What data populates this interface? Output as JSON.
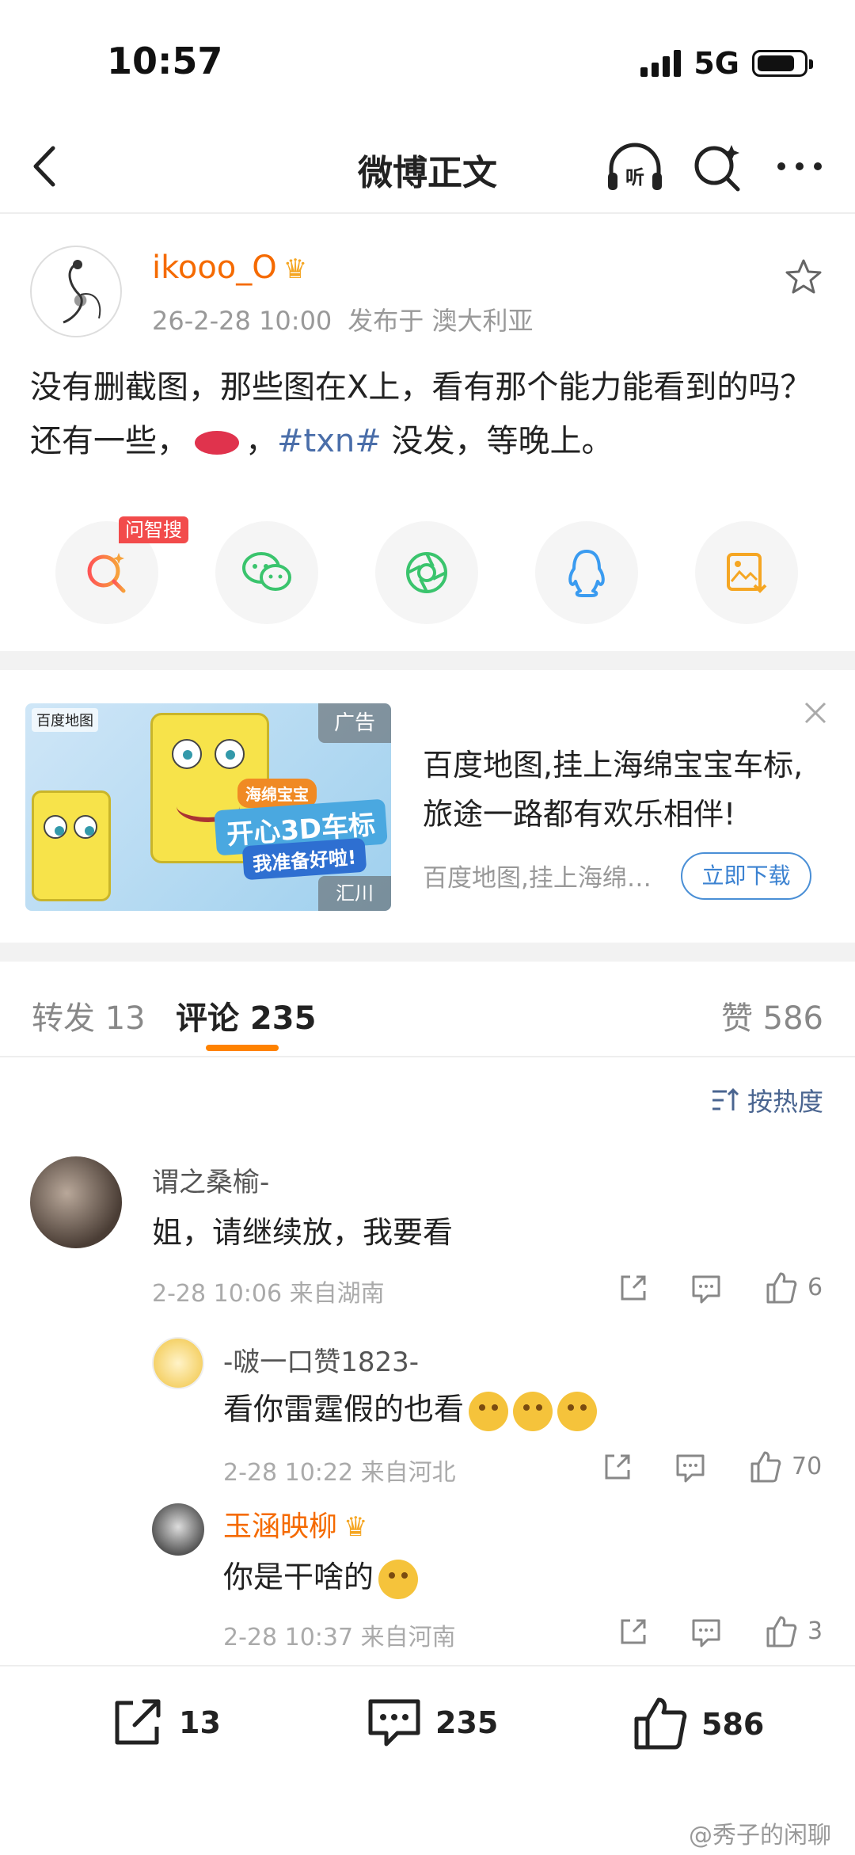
{
  "status_bar": {
    "time": "10:57",
    "network": "5G"
  },
  "nav": {
    "title": "微博正文"
  },
  "post": {
    "author": "ikooo_O",
    "date": "26-2-28 10:00",
    "location": "发布于 澳大利亚",
    "text_part1": "没有删截图，那些图在X上，看有那个能力能看到的吗？还有一些，",
    "text_part2": "，",
    "hashtag": "#txn#",
    "text_part3": " 没发，等晚上。"
  },
  "share": {
    "badge": "问智搜"
  },
  "ad": {
    "logo_text": "百度地图",
    "tag": "广告",
    "brand": "汇川",
    "banner_small": "海绵宝宝",
    "banner_big": "开心3D车标",
    "banner_sub": "我准备好啦!",
    "title": "百度地图,挂上海绵宝宝车标,旅途一路都有欢乐相伴!",
    "desc": "百度地图,挂上海绵宝宝车标,旅途一路都有欢乐相伴!",
    "button": "立即下载"
  },
  "tabs": {
    "repost_label": "转发 13",
    "comment_label": "评论 235",
    "like_label": "赞 586"
  },
  "sort_label": "按热度",
  "comments": [
    {
      "name": "谓之桑榆-",
      "text": "姐，请继续放，我要看",
      "time": "2-28 10:06  来自湖南",
      "likes": "6"
    },
    {
      "name": "-啵一口赞1823-",
      "text": "看你雷霆假的也看",
      "time": "2-28 10:22  来自河北",
      "likes": "70"
    },
    {
      "name": "玉涵映柳",
      "text": "你是干啥的",
      "time": "2-28 10:37  来自河南",
      "likes": "3"
    }
  ],
  "bottom_bar": {
    "repost_count": "13",
    "comment_count": "235",
    "like_count": "586"
  },
  "watermark": "@秀子的闲聊",
  "colors": {
    "accent_orange": "#ff8200",
    "link_blue": "#4a6ea9"
  }
}
